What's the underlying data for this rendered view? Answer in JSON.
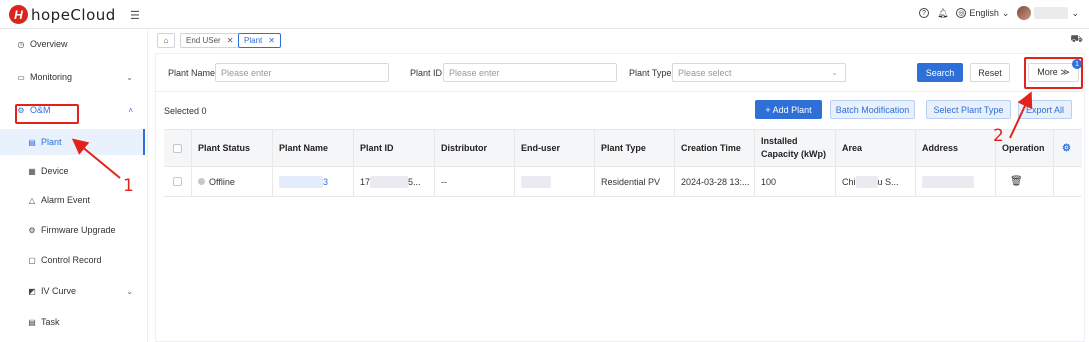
{
  "app": {
    "logo_letter": "H",
    "name": "hopeCloud",
    "menu_icon": "menu-fold-icon"
  },
  "header": {
    "help_icon": "question-icon",
    "notification_icon": "bell-icon",
    "language_icon": "globe-icon",
    "language": "English",
    "language_chevron": "⌄"
  },
  "sidebar": {
    "items": [
      {
        "label": "Overview",
        "icon": "dashboard-icon",
        "glyph": "◷"
      },
      {
        "label": "Monitoring",
        "icon": "monitor-icon",
        "glyph": "▭",
        "chevron": "⌄"
      },
      {
        "label": "O&M",
        "icon": "om-icon",
        "glyph": "⚙",
        "chevron": "˄"
      },
      {
        "label": "Plant",
        "icon": "plant-icon",
        "glyph": "▤"
      },
      {
        "label": "Device",
        "icon": "device-icon",
        "glyph": "▦"
      },
      {
        "label": "Alarm Event",
        "icon": "alarm-icon",
        "glyph": "△"
      },
      {
        "label": "Firmware Upgrade",
        "icon": "firmware-icon",
        "glyph": "⚙"
      },
      {
        "label": "Control Record",
        "icon": "record-icon",
        "glyph": "▢"
      },
      {
        "label": "IV Curve",
        "icon": "iv-curve-icon",
        "glyph": "◩",
        "chevron": "⌄"
      },
      {
        "label": "Task",
        "icon": "task-icon",
        "glyph": "▤"
      }
    ]
  },
  "tabs": {
    "home_icon": "home-icon",
    "items": [
      {
        "label": "End USer",
        "close": "✕"
      },
      {
        "label": "Plant",
        "close": "✕"
      }
    ],
    "basket_icon": "basket-icon"
  },
  "filters": {
    "plant_name_label": "Plant Name",
    "plant_name_placeholder": "Please enter",
    "plant_id_label": "Plant ID",
    "plant_id_placeholder": "Please enter",
    "plant_type_label": "Plant Type",
    "plant_type_placeholder": "Please select",
    "search_label": "Search",
    "reset_label": "Reset",
    "more_label": "More ≫",
    "more_badge": "1"
  },
  "toolbar": {
    "selected_text": "Selected 0",
    "add_plant_label": "+ Add Plant",
    "batch_label": "Batch Modification",
    "select_type_label": "Select Plant Type",
    "export_label": "Export All"
  },
  "table": {
    "columns": [
      "Plant Status",
      "Plant Name",
      "Plant ID",
      "Distributor",
      "End-user",
      "Plant Type",
      "Creation Time",
      "Installed Capacity (kWp)",
      "Area",
      "Address",
      "Operation"
    ],
    "settings_icon": "gear-icon",
    "rows": [
      {
        "status": "Offline",
        "name_visible": "3",
        "id_prefix": "17",
        "id_suffix": "5...",
        "distributor": "--",
        "plant_type": "Residential PV",
        "creation_time": "2024-03-28 13:...",
        "capacity": "100",
        "area_prefix": "Chi",
        "area_suffix": "u S...",
        "delete_icon": "trash-icon"
      }
    ]
  },
  "annotations": {
    "step1": "1",
    "step2": "2",
    "color": "#e3231b"
  },
  "colors": {
    "primary": "#2f6fd8",
    "brand_red": "#d7261e"
  }
}
